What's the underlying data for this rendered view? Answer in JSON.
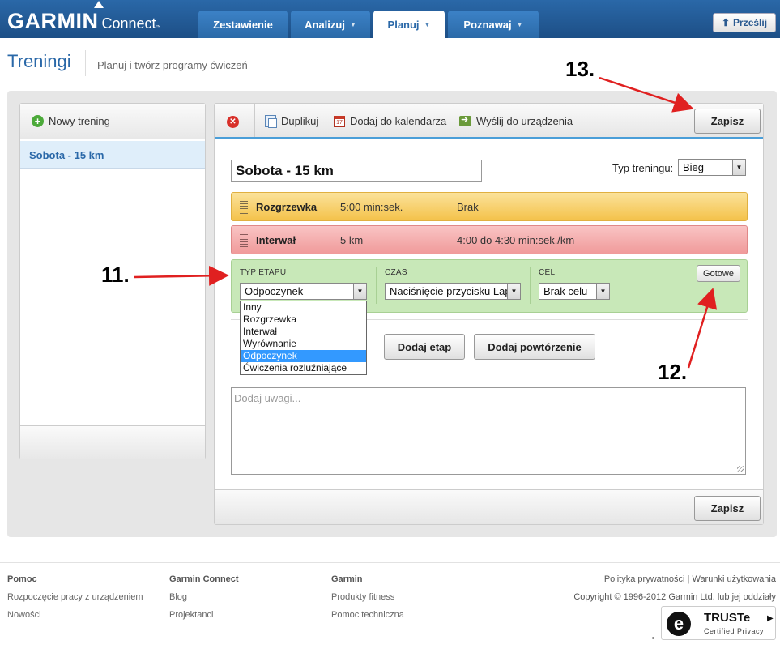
{
  "header": {
    "brand": "GARMIN",
    "product": "Connect",
    "tm": "™",
    "tabs": [
      {
        "label": "Zestawienie"
      },
      {
        "label": "Analizuj"
      },
      {
        "label": "Planuj"
      },
      {
        "label": "Poznawaj"
      }
    ],
    "send_label": "Prześlij"
  },
  "page": {
    "title": "Treningi",
    "subtitle": "Planuj i twórz programy ćwiczeń"
  },
  "sidebar": {
    "new_label": "Nowy trening",
    "items": [
      {
        "label": "Sobota - 15 km"
      }
    ]
  },
  "toolbar": {
    "duplicate": "Duplikuj",
    "calendar": "Dodaj do kalendarza",
    "send": "Wyślij do urządzenia",
    "save": "Zapisz",
    "calendar_icon_text": "17"
  },
  "workout": {
    "name": "Sobota - 15 km",
    "type_label": "Typ treningu:",
    "type_value": "Bieg",
    "steps": [
      {
        "name": "Rozgrzewka",
        "duration": "5:00 min:sek.",
        "target": "Brak"
      },
      {
        "name": "Interwał",
        "duration": "5 km",
        "target": "4:00 do 4:30 min:sek./km"
      }
    ],
    "edit": {
      "type_label": "TYP ETAPU",
      "type_value": "Odpoczynek",
      "time_label": "CZAS",
      "time_value": "Naciśnięcie przycisku Lap",
      "goal_label": "CEL",
      "goal_value": "Brak celu",
      "done_label": "Gotowe",
      "options": [
        "Inny",
        "Rozgrzewka",
        "Interwał",
        "Wyrównanie",
        "Odpoczynek",
        "Ćwiczenia rozluźniające"
      ]
    },
    "add_step": "Dodaj etap",
    "add_repeat": "Dodaj powtórzenie",
    "notes_placeholder": "Dodaj uwagi...",
    "save_bottom": "Zapisz"
  },
  "annotations": {
    "a11": "11.",
    "a12": "12.",
    "a13": "13.",
    "color": "#e02020"
  },
  "footer": {
    "col1": {
      "title": "Pomoc",
      "links": [
        "Rozpoczęcie pracy z urządzeniem",
        "Nowości"
      ]
    },
    "col2": {
      "title": "Garmin Connect",
      "links": [
        "Blog",
        "Projektanci"
      ]
    },
    "col3": {
      "title": "Garmin",
      "links": [
        "Produkty fitness",
        "Pomoc techniczna"
      ]
    },
    "policy": "Polityka prywatności | Warunki użytkowania",
    "copyright": "Copyright © 1996-2012 Garmin Ltd. lub jej oddziały",
    "truste_title": "TRUSTe",
    "truste_sub": "Certified Privacy"
  }
}
